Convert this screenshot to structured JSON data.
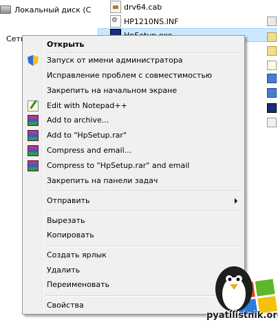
{
  "explorer": {
    "nav": {
      "local_disk": "Локальный диск (C",
      "network": "Сеть"
    },
    "files": [
      {
        "name": "drv64.cab",
        "icon": "cab-file-icon"
      },
      {
        "name": "HP1210NS.INF",
        "icon": "inf-file-icon"
      },
      {
        "name": "HpSetup.exe",
        "icon": "exe-file-icon"
      }
    ]
  },
  "context_menu": {
    "items": [
      {
        "label": "Открыть",
        "bold": true
      },
      {
        "label": "Запуск от имени администратора",
        "icon": "uac-shield-icon"
      },
      {
        "label": "Исправление проблем с совместимостью"
      },
      {
        "label": "Закрепить на начальном экране"
      },
      {
        "label": "Edit with Notepad++",
        "icon": "notepad-plus-plus-icon"
      },
      {
        "label": "Add to archive...",
        "icon": "winrar-icon"
      },
      {
        "label": "Add to \"HpSetup.rar\"",
        "icon": "winrar-icon"
      },
      {
        "label": "Compress and email...",
        "icon": "winrar-icon"
      },
      {
        "label": "Compress to \"HpSetup.rar\" and email",
        "icon": "winrar-icon"
      },
      {
        "label": "Закрепить на панели задач"
      },
      {
        "label": "Отправить",
        "submenu": true
      },
      {
        "label": "Вырезать"
      },
      {
        "label": "Копировать"
      },
      {
        "label": "Создать ярлык"
      },
      {
        "label": "Удалить"
      },
      {
        "label": "Переименовать"
      },
      {
        "label": "Свойства"
      }
    ]
  },
  "watermark": {
    "text": "pyatilistnik.org",
    "icon": "penguin-windows-logo"
  }
}
